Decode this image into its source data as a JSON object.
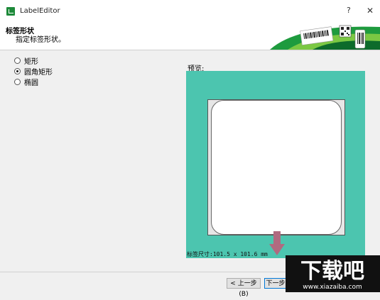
{
  "window": {
    "title": "LabelEditor",
    "help_label": "?",
    "close_label": "✕"
  },
  "header": {
    "title": "标签形状",
    "subtitle": "指定标签形状。"
  },
  "options": [
    {
      "label": "矩形",
      "selected": false
    },
    {
      "label": "圆角矩形",
      "selected": true
    },
    {
      "label": "椭圆",
      "selected": false
    }
  ],
  "preview": {
    "label": "预览:",
    "size_text": "标签尺寸:101.5 x 101.6 mm",
    "background_color": "#4cc5af"
  },
  "buttons": {
    "prev": "< 上一步(B)",
    "next": "下一步"
  },
  "watermark": {
    "brand": "下载吧",
    "url": "www.xiazaiba.com"
  },
  "colors": {
    "accent": "#0078d7",
    "brand_green": "#1e8a3a",
    "arrow": "#b06a80"
  },
  "icons": [
    "app-icon",
    "help-icon",
    "close-icon",
    "down-arrow-icon"
  ]
}
